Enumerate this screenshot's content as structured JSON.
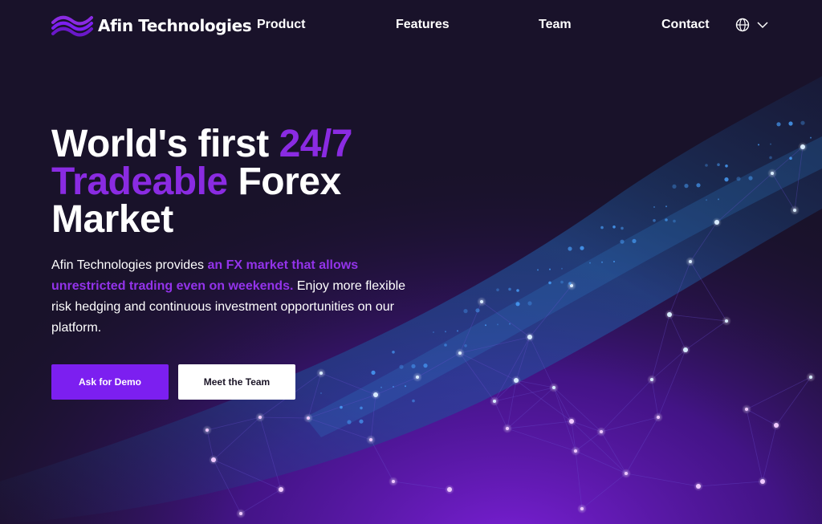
{
  "brand": {
    "name": "Afin Technologies"
  },
  "nav": {
    "links": [
      {
        "label": "Product"
      },
      {
        "label": "Features"
      },
      {
        "label": "Team"
      },
      {
        "label": "Contact"
      }
    ],
    "language_icon": "globe-icon",
    "language_chevron": "chevron-down-icon"
  },
  "hero": {
    "title_part1": "World's first ",
    "title_highlight": "24/7 Tradeable",
    "title_part2": " Forex Market",
    "desc_part1": "Afin Technologies provides ",
    "desc_highlight": "an FX market that allows unrestricted trading even on weekends.",
    "desc_part2": " Enjoy more flexible risk hedging and continuous investment opportunities on our platform."
  },
  "buttons": {
    "demo": "Ask for Demo",
    "team": "Meet the Team"
  },
  "colors": {
    "background": "#19122a",
    "accent": "#8a2be2",
    "button_primary": "#7c1ff0",
    "button_secondary": "#ffffff"
  }
}
